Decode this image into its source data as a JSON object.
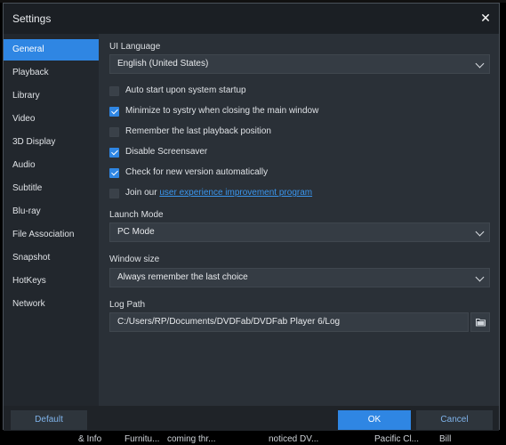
{
  "dialog": {
    "title": "Settings",
    "close_icon": "close-icon"
  },
  "sidebar": {
    "items": [
      {
        "label": "General",
        "active": true
      },
      {
        "label": "Playback"
      },
      {
        "label": "Library"
      },
      {
        "label": "Video"
      },
      {
        "label": "3D Display"
      },
      {
        "label": "Audio"
      },
      {
        "label": "Subtitle"
      },
      {
        "label": "Blu-ray"
      },
      {
        "label": "File Association"
      },
      {
        "label": "Snapshot"
      },
      {
        "label": "HotKeys"
      },
      {
        "label": "Network"
      }
    ]
  },
  "general": {
    "ui_language": {
      "label": "UI Language",
      "value": "English (United States)"
    },
    "checks": [
      {
        "label": "Auto start upon system startup",
        "checked": false
      },
      {
        "label": "Minimize to systry when closing the main window",
        "checked": true
      },
      {
        "label": "Remember the last playback position",
        "checked": false
      },
      {
        "label": "Disable Screensaver",
        "checked": true
      },
      {
        "label": "Check for new version automatically",
        "checked": true
      }
    ],
    "join": {
      "prefix": "Join our ",
      "link": "user experience improvement program",
      "checked": false
    },
    "launch_mode": {
      "label": "Launch Mode",
      "value": "PC Mode"
    },
    "window_size": {
      "label": "Window size",
      "value": "Always remember the last choice"
    },
    "log_path": {
      "label": "Log Path",
      "value": "C:/Users/RP/Documents/DVDFab/DVDFab Player 6/Log"
    }
  },
  "footer": {
    "default_label": "Default",
    "ok_label": "OK",
    "cancel_label": "Cancel"
  },
  "taskbar": {
    "items": [
      "& Info",
      "Furnitu...",
      "coming thr...",
      "noticed DV...",
      "Pacific Cl...",
      "Bill"
    ]
  },
  "colors": {
    "accent": "#2f86e3",
    "background": "#2a3037",
    "sidebar": "#22272d",
    "link": "#3a96ee"
  }
}
